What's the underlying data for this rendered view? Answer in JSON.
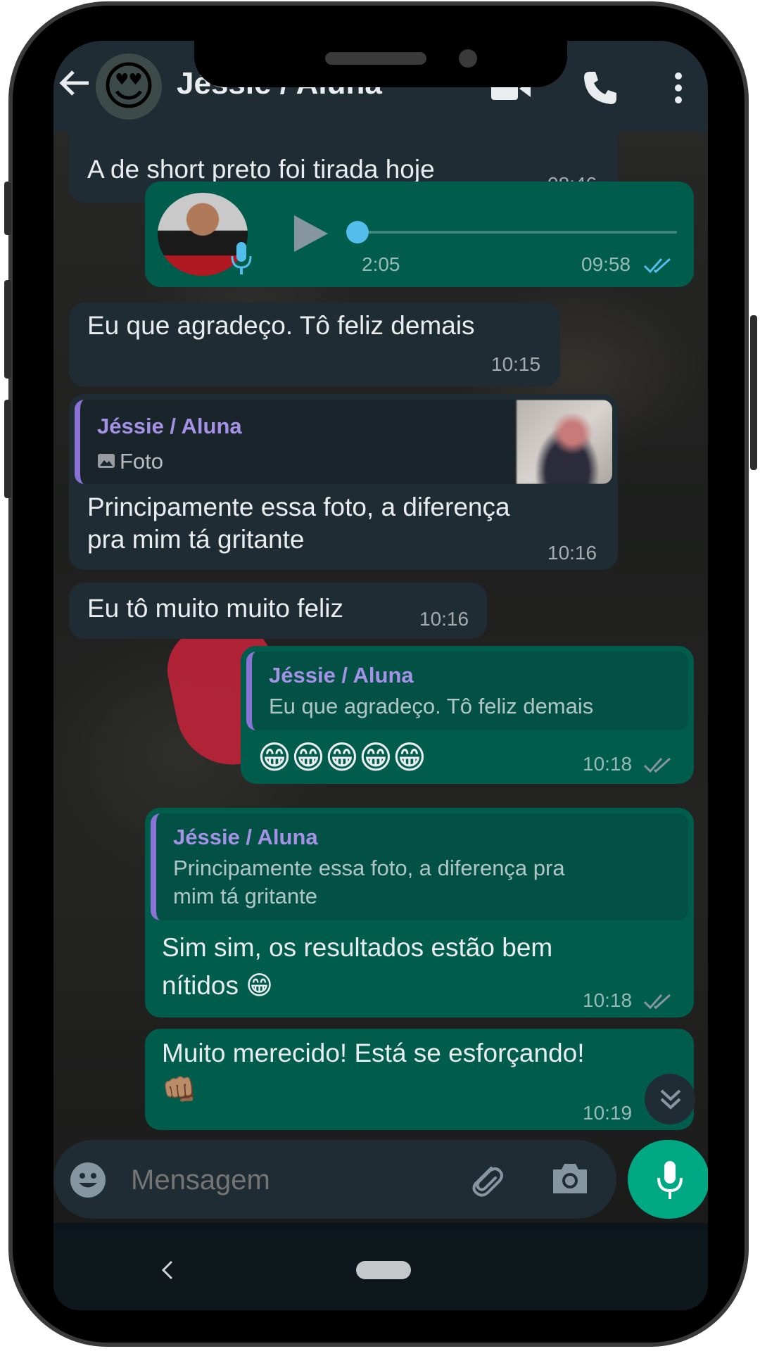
{
  "header": {
    "contact_name": "Jéssie / Aluna",
    "avatar_emoji": "😍",
    "icons": [
      "back-arrow-icon",
      "video-call-icon",
      "voice-call-icon",
      "more-options-icon"
    ]
  },
  "messages": [
    {
      "direction": "in",
      "text": "A de short preto foi tirada hoje",
      "time": "08:46"
    },
    {
      "direction": "out",
      "type": "voice",
      "duration": "2:05",
      "time": "09:58",
      "read": true
    },
    {
      "direction": "in",
      "text": "Eu que agradeço.  Tô feliz demais",
      "time": "10:15"
    },
    {
      "direction": "in",
      "quote": {
        "name": "Jéssie / Aluna",
        "text": "Foto"
      },
      "text_line1": "Principamente essa foto,  a diferença",
      "text_line2": "pra mim tá gritante",
      "time": "10:16"
    },
    {
      "direction": "in",
      "text": "Eu tô muito muito feliz",
      "time": "10:16"
    },
    {
      "direction": "out",
      "quote": {
        "name": "Jéssie / Aluna",
        "text": "Eu que agradeço.  Tô feliz demais"
      },
      "text": "😁😁😁😁😁",
      "time": "10:18"
    },
    {
      "direction": "out",
      "quote": {
        "name": "Jéssie / Aluna",
        "text_line1": "Principamente essa foto,  a diferença pra",
        "text_line2": "mim tá gritante"
      },
      "text_line1": "Sim sim, os resultados estão bem",
      "text_line2": "nítidos 😁",
      "time": "10:18"
    },
    {
      "direction": "out",
      "text_line1": "Muito merecido! Está se esforçando!",
      "text_line2": "👊🏽",
      "time": "10:19"
    }
  ],
  "input": {
    "placeholder": "Mensagem"
  },
  "colors": {
    "header": "#1f2c34",
    "incoming": "#202c33",
    "outgoing": "#005c4b",
    "accent": "#00a884",
    "quote_name": "#a591e6",
    "read_ticks": "#53bdeb"
  }
}
